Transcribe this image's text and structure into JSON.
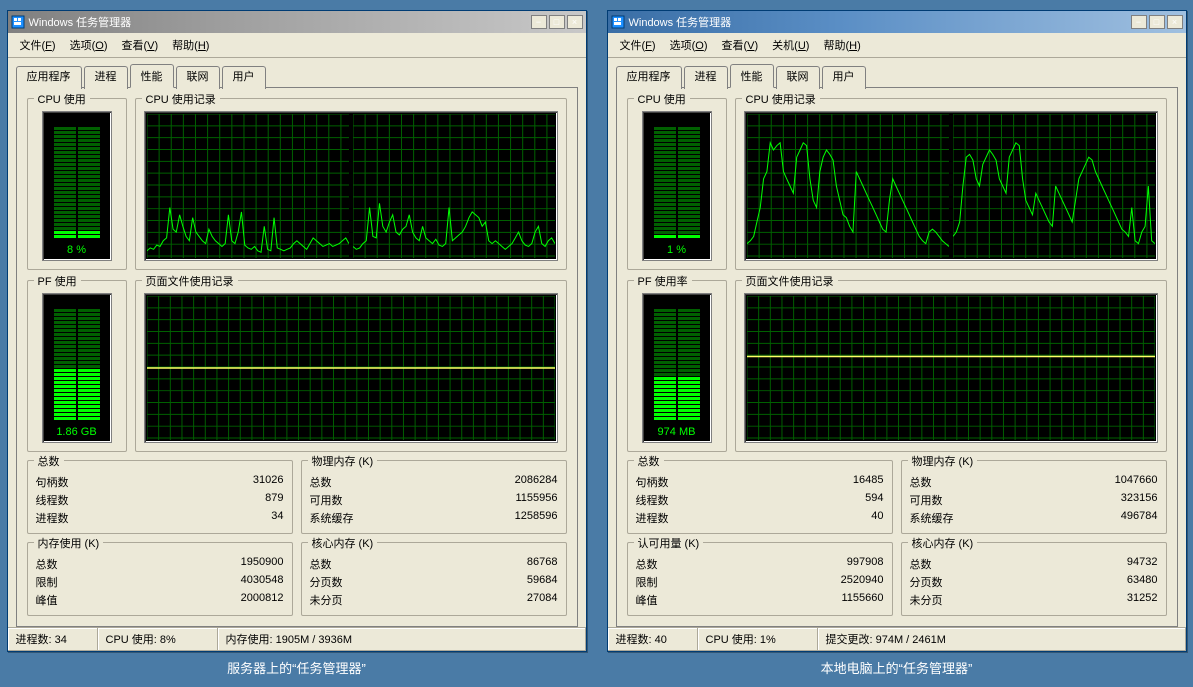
{
  "windows": [
    {
      "title": "Windows 任务管理器",
      "active_titlebar": false,
      "menu": [
        {
          "label": "文件(",
          "key": "F",
          "tail": ")"
        },
        {
          "label": "选项(",
          "key": "O",
          "tail": ")"
        },
        {
          "label": "查看(",
          "key": "V",
          "tail": ")"
        },
        {
          "label": "帮助(",
          "key": "H",
          "tail": ")"
        }
      ],
      "tabs": [
        "应用程序",
        "进程",
        "性能",
        "联网",
        "用户"
      ],
      "active_tab": 2,
      "cpu_box": {
        "label": "CPU 使用",
        "value": "8 %",
        "level_pct": 8
      },
      "cpu_history_label": "CPU 使用记录",
      "cpu_series": [
        [
          5,
          7,
          6,
          9,
          8,
          12,
          14,
          35,
          20,
          18,
          30,
          22,
          15,
          12,
          28,
          18,
          15,
          12,
          10,
          20,
          15,
          12,
          10,
          8,
          10,
          30,
          12,
          10,
          18,
          32,
          9,
          7,
          6,
          8,
          5,
          4,
          22,
          6,
          5,
          28,
          7,
          6,
          5,
          6,
          7,
          10,
          12,
          10,
          8,
          6,
          10,
          14,
          12,
          10,
          8,
          9,
          10,
          8,
          9,
          10,
          12,
          14,
          10
        ],
        [
          8,
          6,
          7,
          10,
          12,
          35,
          15,
          14,
          38,
          22,
          18,
          25,
          30,
          18,
          16,
          20,
          22,
          30,
          18,
          14,
          12,
          22,
          14,
          12,
          10,
          13,
          9,
          8,
          10,
          35,
          12,
          14,
          16,
          18,
          22,
          28,
          32,
          30,
          28,
          22,
          25,
          12,
          10,
          12,
          10,
          8,
          6,
          8,
          10,
          14,
          18,
          12,
          9,
          8,
          10,
          18,
          22,
          10,
          8,
          12,
          14,
          10
        ]
      ],
      "pf_box": {
        "label": "PF 使用",
        "value": "1.86 GB",
        "level_pct": 48
      },
      "pf_history_label": "页面文件使用记录",
      "pf_y_pct": 50,
      "stats": {
        "totals": {
          "legend": "总数",
          "rows": [
            [
              "句柄数",
              "31026"
            ],
            [
              "线程数",
              "879"
            ],
            [
              "进程数",
              "34"
            ]
          ]
        },
        "phys": {
          "legend": "物理内存 (K)",
          "rows": [
            [
              "总数",
              "2086284"
            ],
            [
              "可用数",
              "1155956"
            ],
            [
              "系统缓存",
              "1258596"
            ]
          ]
        },
        "commit": {
          "legend": "内存使用 (K)",
          "rows": [
            [
              "总数",
              "1950900"
            ],
            [
              "限制",
              "4030548"
            ],
            [
              "峰值",
              "2000812"
            ]
          ]
        },
        "kernel": {
          "legend": "核心内存 (K)",
          "rows": [
            [
              "总数",
              "86768"
            ],
            [
              "分页数",
              "59684"
            ],
            [
              "未分页",
              "27084"
            ]
          ]
        }
      },
      "status": {
        "p": "进程数: 34",
        "c": "CPU 使用: 8%",
        "m": "内存使用: 1905M / 3936M"
      },
      "caption": "服务器上的“任务管理器”"
    },
    {
      "title": "Windows 任务管理器",
      "active_titlebar": true,
      "menu": [
        {
          "label": "文件(",
          "key": "F",
          "tail": ")"
        },
        {
          "label": "选项(",
          "key": "O",
          "tail": ")"
        },
        {
          "label": "查看(",
          "key": "V",
          "tail": ")"
        },
        {
          "label": "关机(",
          "key": "U",
          "tail": ")"
        },
        {
          "label": "帮助(",
          "key": "H",
          "tail": ")"
        }
      ],
      "tabs": [
        "应用程序",
        "进程",
        "性能",
        "联网",
        "用户"
      ],
      "active_tab": 2,
      "cpu_box": {
        "label": "CPU 使用",
        "value": "1 %",
        "level_pct": 3
      },
      "cpu_history_label": "CPU 使用记录",
      "cpu_series": [
        [
          10,
          12,
          15,
          25,
          35,
          55,
          60,
          80,
          75,
          78,
          80,
          60,
          55,
          50,
          45,
          70,
          75,
          80,
          78,
          55,
          40,
          35,
          60,
          70,
          75,
          72,
          68,
          50,
          40,
          30,
          28,
          22,
          18,
          60,
          55,
          50,
          45,
          40,
          35,
          30,
          25,
          20,
          18,
          40,
          55,
          50,
          45,
          40,
          35,
          30,
          25,
          20,
          15,
          12,
          10,
          18,
          20,
          18,
          15,
          12,
          10,
          8
        ],
        [
          15,
          18,
          25,
          50,
          70,
          72,
          68,
          55,
          50,
          65,
          70,
          75,
          72,
          68,
          55,
          50,
          45,
          70,
          75,
          80,
          78,
          55,
          40,
          35,
          30,
          45,
          40,
          35,
          30,
          25,
          22,
          50,
          45,
          40,
          35,
          30,
          25,
          40,
          55,
          60,
          65,
          70,
          68,
          60,
          55,
          50,
          45,
          40,
          35,
          30,
          25,
          20,
          18,
          15,
          35,
          12,
          10,
          18,
          22,
          50,
          12,
          10
        ]
      ],
      "pf_box": {
        "label": "PF 使用率",
        "value": "974 MB",
        "level_pct": 40
      },
      "pf_history_label": "页面文件使用记录",
      "pf_y_pct": 58,
      "stats": {
        "totals": {
          "legend": "总数",
          "rows": [
            [
              "句柄数",
              "16485"
            ],
            [
              "线程数",
              "594"
            ],
            [
              "进程数",
              "40"
            ]
          ]
        },
        "phys": {
          "legend": "物理内存 (K)",
          "rows": [
            [
              "总数",
              "1047660"
            ],
            [
              "可用数",
              "323156"
            ],
            [
              "系统缓存",
              "496784"
            ]
          ]
        },
        "commit": {
          "legend": "认可用量 (K)",
          "rows": [
            [
              "总数",
              "997908"
            ],
            [
              "限制",
              "2520940"
            ],
            [
              "峰值",
              "1155660"
            ]
          ]
        },
        "kernel": {
          "legend": "核心内存 (K)",
          "rows": [
            [
              "总数",
              "94732"
            ],
            [
              "分页数",
              "63480"
            ],
            [
              "未分页",
              "31252"
            ]
          ]
        }
      },
      "status": {
        "p": "进程数: 40",
        "c": "CPU 使用: 1%",
        "m": "提交更改: 974M / 2461M"
      },
      "caption": "本地电脑上的“任务管理器”"
    }
  ],
  "chart_data": [
    {
      "type": "bar",
      "title": "CPU 使用 (server)",
      "categories": [
        "CPU"
      ],
      "values": [
        8
      ],
      "ylim": [
        0,
        100
      ],
      "xlabel": "",
      "ylabel": "%"
    },
    {
      "type": "line",
      "title": "CPU 使用记录 (server, core 0)",
      "x": null,
      "series": [
        {
          "name": "core0",
          "values": [
            5,
            7,
            6,
            9,
            8,
            12,
            14,
            35,
            20,
            18,
            30,
            22,
            15,
            12,
            28,
            18,
            15,
            12,
            10,
            20,
            15,
            12,
            10,
            8,
            10,
            30,
            12,
            10,
            18,
            32,
            9,
            7,
            6,
            8,
            5,
            4,
            22,
            6,
            5,
            28,
            7,
            6,
            5,
            6,
            7,
            10,
            12,
            10,
            8,
            6,
            10,
            14,
            12,
            10,
            8,
            9,
            10,
            8,
            9,
            10,
            12,
            14,
            10
          ]
        }
      ],
      "ylim": [
        0,
        100
      ],
      "xlabel": "",
      "ylabel": "%"
    },
    {
      "type": "line",
      "title": "CPU 使用记录 (server, core 1)",
      "x": null,
      "series": [
        {
          "name": "core1",
          "values": [
            8,
            6,
            7,
            10,
            12,
            35,
            15,
            14,
            38,
            22,
            18,
            25,
            30,
            18,
            16,
            20,
            22,
            30,
            18,
            14,
            12,
            22,
            14,
            12,
            10,
            13,
            9,
            8,
            10,
            35,
            12,
            14,
            16,
            18,
            22,
            28,
            32,
            30,
            28,
            22,
            25,
            12,
            10,
            12,
            10,
            8,
            6,
            8,
            10,
            14,
            18,
            12,
            9,
            8,
            10,
            18,
            22,
            10,
            8,
            12,
            14,
            10
          ]
        }
      ],
      "ylim": [
        0,
        100
      ],
      "xlabel": "",
      "ylabel": "%"
    },
    {
      "type": "line",
      "title": "页面文件使用记录 (server)",
      "x": null,
      "series": [
        {
          "name": "pf",
          "values": [
            50,
            50,
            50,
            50,
            50,
            50,
            50,
            50,
            50,
            50
          ]
        }
      ],
      "ylim": [
        0,
        100
      ],
      "xlabel": "",
      "ylabel": "%"
    },
    {
      "type": "bar",
      "title": "CPU 使用 (local)",
      "categories": [
        "CPU"
      ],
      "values": [
        1
      ],
      "ylim": [
        0,
        100
      ],
      "xlabel": "",
      "ylabel": "%"
    },
    {
      "type": "line",
      "title": "CPU 使用记录 (local, core 0)",
      "x": null,
      "series": [
        {
          "name": "core0",
          "values": [
            10,
            12,
            15,
            25,
            35,
            55,
            60,
            80,
            75,
            78,
            80,
            60,
            55,
            50,
            45,
            70,
            75,
            80,
            78,
            55,
            40,
            35,
            60,
            70,
            75,
            72,
            68,
            50,
            40,
            30,
            28,
            22,
            18,
            60,
            55,
            50,
            45,
            40,
            35,
            30,
            25,
            20,
            18,
            40,
            55,
            50,
            45,
            40,
            35,
            30,
            25,
            20,
            15,
            12,
            10,
            18,
            20,
            18,
            15,
            12,
            10,
            8
          ]
        }
      ],
      "ylim": [
        0,
        100
      ],
      "xlabel": "",
      "ylabel": "%"
    },
    {
      "type": "line",
      "title": "CPU 使用记录 (local, core 1)",
      "x": null,
      "series": [
        {
          "name": "core1",
          "values": [
            15,
            18,
            25,
            50,
            70,
            72,
            68,
            55,
            50,
            65,
            70,
            75,
            72,
            68,
            55,
            50,
            45,
            70,
            75,
            80,
            78,
            55,
            40,
            35,
            30,
            45,
            40,
            35,
            30,
            25,
            22,
            50,
            45,
            40,
            35,
            30,
            25,
            40,
            55,
            60,
            65,
            70,
            68,
            60,
            55,
            50,
            45,
            40,
            35,
            30,
            25,
            20,
            18,
            15,
            35,
            12,
            10,
            18,
            22,
            50,
            12,
            10
          ]
        }
      ],
      "ylim": [
        0,
        100
      ],
      "xlabel": "",
      "ylabel": "%"
    },
    {
      "type": "line",
      "title": "页面文件使用记录 (local)",
      "x": null,
      "series": [
        {
          "name": "pf",
          "values": [
            58,
            58,
            58,
            58,
            58,
            58,
            58,
            58,
            58,
            58
          ]
        }
      ],
      "ylim": [
        0,
        100
      ],
      "xlabel": "",
      "ylabel": "%"
    }
  ]
}
